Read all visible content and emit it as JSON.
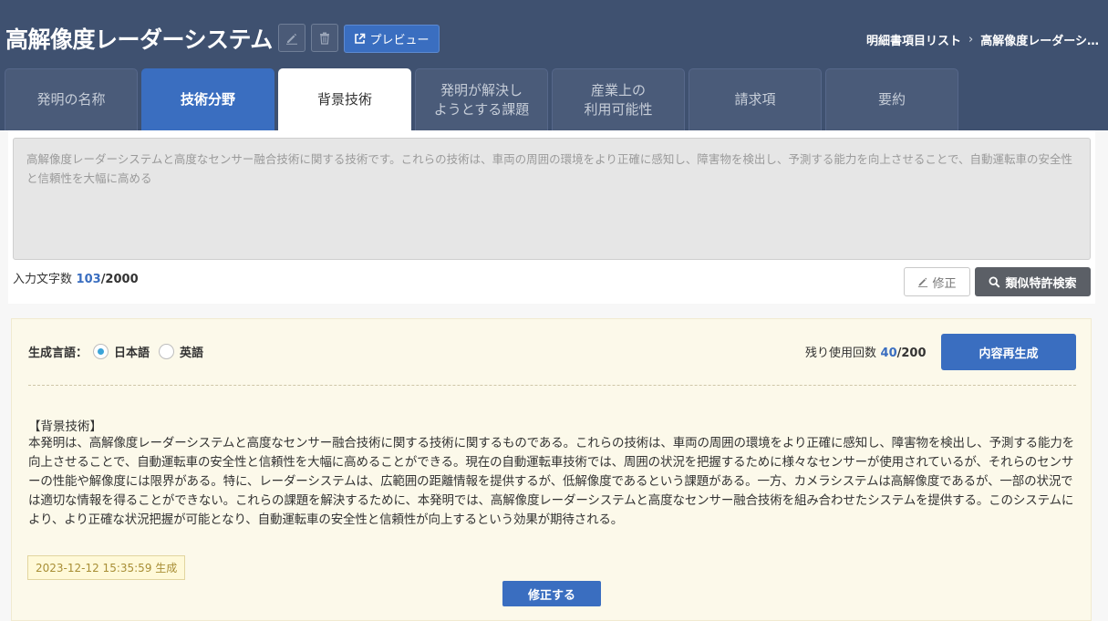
{
  "header": {
    "title": "高解像度レーダーシステム",
    "edit_icon": "pencil-icon",
    "delete_icon": "trash-icon",
    "preview_label": "プレビュー",
    "preview_icon": "external-link-icon"
  },
  "breadcrumb": {
    "parent": "明細書項目リスト",
    "separator": "›",
    "current": "高解像度レーダーシ…"
  },
  "tabs": [
    {
      "label": "発明の名称",
      "state": "normal"
    },
    {
      "label": "技術分野",
      "state": "highlighted"
    },
    {
      "label": "背景技術",
      "state": "active"
    },
    {
      "label": "発明が解決し\nようとする課題",
      "state": "normal"
    },
    {
      "label": "産業上の\n利用可能性",
      "state": "normal"
    },
    {
      "label": "請求項",
      "state": "normal"
    },
    {
      "label": "要約",
      "state": "normal"
    }
  ],
  "input": {
    "text": "高解像度レーダーシステムと高度なセンサー融合技術に関する技術です。これらの技術は、車両の周囲の環境をより正確に感知し、障害物を検出し、予測する能力を向上させることで、自動運転車の安全性と信頼性を大幅に高める",
    "count_label": "入力文字数",
    "count_current": "103",
    "count_max": "/2000",
    "edit_label": "修正",
    "search_label": "類似特許検索"
  },
  "generation": {
    "language_label": "生成言語：",
    "languages": [
      {
        "label": "日本語",
        "selected": true
      },
      {
        "label": "英語",
        "selected": false
      }
    ],
    "remaining_label": "残り使用回数",
    "remaining_current": "40",
    "remaining_max": "/200",
    "regenerate_label": "内容再生成",
    "result_heading": "【背景技術】",
    "result_body": "本発明は、高解像度レーダーシステムと高度なセンサー融合技術に関する技術に関するものである。これらの技術は、車両の周囲の環境をより正確に感知し、障害物を検出し、予測する能力を向上させることで、自動運転車の安全性と信頼性を大幅に高めることができる。現在の自動運転車技術では、周囲の状況を把握するために様々なセンサーが使用されているが、それらのセンサーの性能や解像度には限界がある。特に、レーダーシステムは、広範囲の距離情報を提供するが、低解像度であるという課題がある。一方、カメラシステムは高解像度であるが、一部の状況では適切な情報を得ることができない。これらの課題を解決するために、本発明では、高解像度レーダーシステムと高度なセンサー融合技術を組み合わせたシステムを提供する。このシステムにより、より正確な状況把握が可能となり、自動運転車の安全性と信頼性が向上するという効果が期待される。",
    "timestamp": "2023-12-12 15:35:59 生成",
    "fix_label": "修正する"
  }
}
